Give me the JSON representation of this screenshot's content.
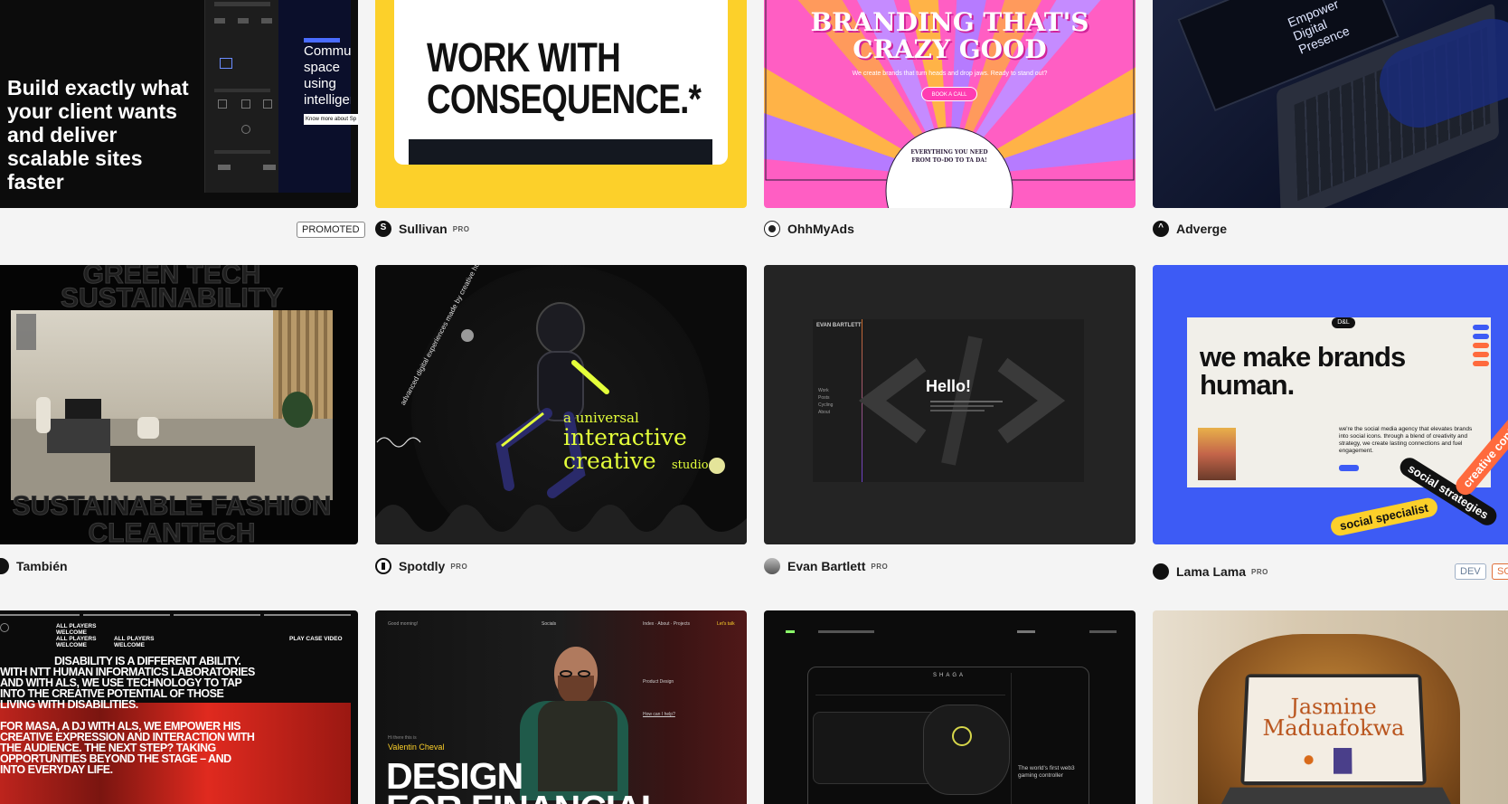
{
  "row1": {
    "webflow": {
      "headline": "Build exactly what your client wants and deliver scalable sites faster",
      "side_text": "Community space using intelligence learning",
      "side_button": "Know more about Sp",
      "badge": "PROMOTED"
    },
    "sullivan": {
      "headline_1": "WORK WITH",
      "headline_2": "CONSEQUENCE.*",
      "name": "Sullivan",
      "badge": "PRO"
    },
    "ohhmyads": {
      "headline_1": "BRANDING THAT'S",
      "headline_2": "CRAZY GOOD",
      "sub": "We create brands that turn heads and drop jaws. Ready to stand out?",
      "cta": "BOOK A CALL",
      "stamp": "EVERYTHING YOU NEED FROM TO-DO TO TA DA!",
      "name": "OhhMyAds"
    },
    "adverge": {
      "screen_text": "Empower Digital Presence",
      "name": "Adverge"
    }
  },
  "row2": {
    "tambien": {
      "top_text_1": "GREEN TECH",
      "top_text_2": "SUSTAINABILITY",
      "bottom_text_1": "SUSTAINABLE FASHION",
      "bottom_text_2": "CLEANTECH",
      "name": "También"
    },
    "spotdly": {
      "circle_text": "advanced digital experiences made by creative humans",
      "line_1": "a universal",
      "line_2": "interactive",
      "line_3": "creative",
      "line_4": "studio",
      "name": "Spotdly",
      "badge": "PRO"
    },
    "evan": {
      "logo": "EVAN BARTLETT",
      "hello": "Hello!",
      "nav": [
        "Work",
        "Posts",
        "Cycling",
        "About"
      ],
      "name": "Evan Bartlett",
      "badge": "PRO"
    },
    "lama": {
      "logo": "D&L",
      "headline": "we make brands human.",
      "body": "we're the social media agency that elevates brands into social icons. through a blend of creativity and strategy, we create lasting connections and fuel engagement.",
      "pill_1": "social specialist",
      "pill_2": "social strategies",
      "pill_3": "creative conte",
      "name": "Lama Lama",
      "badge": "PRO",
      "tag_1": "DEV",
      "tag_2": "SO"
    }
  },
  "row3": {
    "ntt": {
      "top_1": "ALL PLAYERS WELCOME",
      "top_2": "ALL PLAYERS WELCOME",
      "top_3": "ALL PLAYERS WELCOME",
      "play": "PLAY CASE VIDEO",
      "para_1": "DISABILITY IS A DIFFERENT ABILITY. WITH NTT HUMAN INFORMATICS LABORATORIES AND WITH ALS, WE USE TECHNOLOGY TO TAP INTO THE CREATIVE POTENTIAL OF THOSE LIVING WITH DISABILITIES.",
      "para_2": "FOR MASA, A DJ WITH ALS, WE EMPOWER HIS CREATIVE EXPRESSION AND INTERACTION WITH THE AUDIENCE. THE NEXT STEP? TAKING OPPORTUNITIES BEYOND THE STAGE – AND INTO EVERYDAY LIFE."
    },
    "valentin": {
      "greeting": "Good morning!",
      "nav": "Socials",
      "index": "Index · About · Projects",
      "cta": "Let's talk",
      "hi": "Hi there this is",
      "name": "Valentin Cheval",
      "service": "Product Design",
      "headline_1": "DESIGN",
      "headline_2": "FOR FINANCIAL",
      "help": "How can I help?"
    },
    "shaga": {
      "logo": "SHAGA",
      "tagline": "The world's first web3 gaming controller"
    },
    "jasmine": {
      "name_1": "Jasmine",
      "name_2": "Maduafokwa"
    }
  },
  "colors": {
    "sullivan_yellow": "#fcd02a",
    "ohh_pink": "#ff5ec3",
    "lama_blue": "#3d5bf5",
    "spotdly_yellow": "#e4ff3a"
  }
}
